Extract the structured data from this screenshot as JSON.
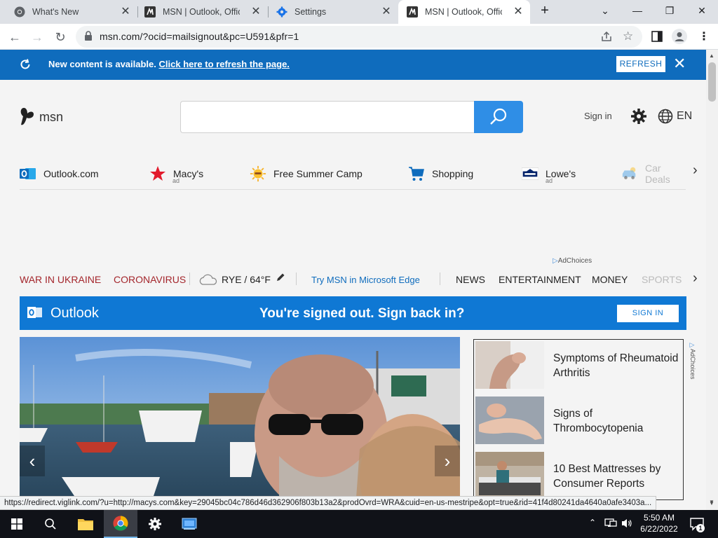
{
  "browser": {
    "tabs": [
      {
        "title": "What's New",
        "favicon": "chrome-icon"
      },
      {
        "title": "MSN | Outlook, Office,",
        "favicon": "msn-icon"
      },
      {
        "title": "Settings",
        "favicon": "gear-icon"
      },
      {
        "title": "MSN | Outlook, Office,",
        "favicon": "msn-icon"
      }
    ],
    "url": "msn.com/?ocid=mailsignout&pc=U591&pfr=1"
  },
  "refresh_banner": {
    "message": "New content is available.",
    "link": "Click here to refresh the page.",
    "button": "REFRESH"
  },
  "header": {
    "logo_text": "msn",
    "search_placeholder": "",
    "signin": "Sign in",
    "language": "EN"
  },
  "quick_links": [
    {
      "label": "Outlook.com",
      "icon": "outlook-icon",
      "ad": ""
    },
    {
      "label": "Macy's",
      "icon": "macys-star-icon",
      "ad": "ad"
    },
    {
      "label": "Free Summer Camp",
      "icon": "sun-icon",
      "ad": ""
    },
    {
      "label": "Shopping",
      "icon": "cart-icon",
      "ad": ""
    },
    {
      "label": "Lowe's",
      "icon": "lowes-icon",
      "ad": "ad"
    },
    {
      "label": "Car Deals",
      "icon": "car-icon",
      "ad": ""
    }
  ],
  "adchoices": "AdChoices",
  "topics": {
    "red": [
      "WAR IN UKRAINE",
      "CORONAVIRUS"
    ],
    "weather": "RYE / 64°F",
    "edge_link": "Try MSN in Microsoft Edge",
    "nav": [
      "NEWS",
      "ENTERTAINMENT",
      "MONEY",
      "SPORTS"
    ]
  },
  "outlook_banner": {
    "name": "Outlook",
    "message": "You're signed out. Sign back in?",
    "button": "SIGN IN"
  },
  "ads": [
    {
      "text": "Symptoms of Rheumatoid Arthritis"
    },
    {
      "text": "Signs of Thrombocytopenia"
    },
    {
      "text": "10 Best Mattresses by Consumer Reports"
    }
  ],
  "status_url": "https://redirect.viglink.com/?u=http://macys.com&key=29045bc04c786d46d362906f803b13a2&prodOvrd=WRA&cuid=en-us-mestripe&opt=true&rid=41f4d80241da4640a0afe3403a...",
  "taskbar": {
    "time": "5:50 AM",
    "date": "6/22/2022",
    "notification_count": "1"
  },
  "colors": {
    "msn_blue": "#0f6cbd",
    "outlook_blue": "#0f78d4",
    "search_blue": "#2f8ee6",
    "topic_red": "#a4262c"
  }
}
